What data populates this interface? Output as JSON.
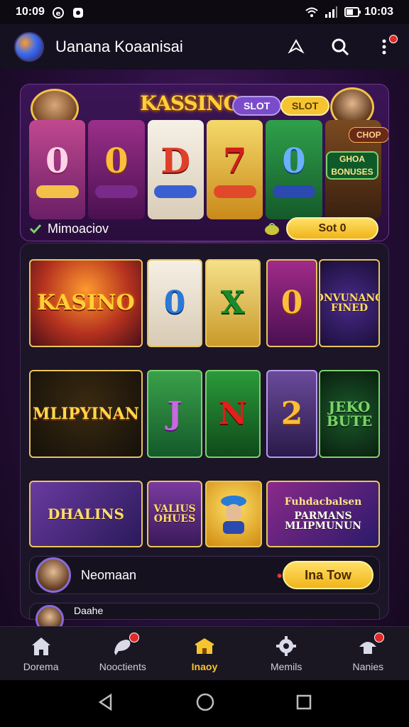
{
  "status_bar": {
    "time": "10:09",
    "clock_right": "10:03"
  },
  "app_bar": {
    "title": "Uanana Koaanisai"
  },
  "featured": {
    "title": "KASSINO",
    "pill_purple": "SLOT",
    "pill_gold": "SLOT",
    "shop_tag": "CHOP",
    "bonus_plate": "GHOA BONUSES",
    "reels": [
      "0",
      "0",
      "D",
      "7",
      "0",
      ""
    ],
    "footer_label": "Mimoaciov",
    "footer_button": "Sot 0"
  },
  "grid": {
    "row1": {
      "big_tile": "KASINO",
      "reel1": "0",
      "reel2": "X",
      "reel3": "0",
      "promo": "ONVUNANO FINED"
    },
    "row2": {
      "big_tile": "MLIPYINAN",
      "reel1": "J",
      "reel2": "N",
      "reel3": "2",
      "promo": "JEKO BUTE"
    },
    "row3": {
      "tile1": "DHALINS",
      "tile2": "VALIUS OHUES",
      "promo_header": "Fuhdacbalsen",
      "promo_body": "PARMANS MLIPMUNUN"
    }
  },
  "list_row_1": {
    "name": "Neomaan",
    "button": "Ina Tow"
  },
  "list_row_2": {
    "name": "Daahe"
  },
  "bottom_nav": [
    {
      "label": "Dorema",
      "icon": "home-icon"
    },
    {
      "label": "Nooctients",
      "icon": "chat-icon"
    },
    {
      "label": "Inaoy",
      "icon": "store-icon"
    },
    {
      "label": "Memils",
      "icon": "settings-icon"
    },
    {
      "label": "Nanies",
      "icon": "profile-icon"
    }
  ],
  "colors": {
    "accent_gold": "#f6c431",
    "accent_purple": "#7a4cc9",
    "badge_red": "#e02a2a"
  }
}
